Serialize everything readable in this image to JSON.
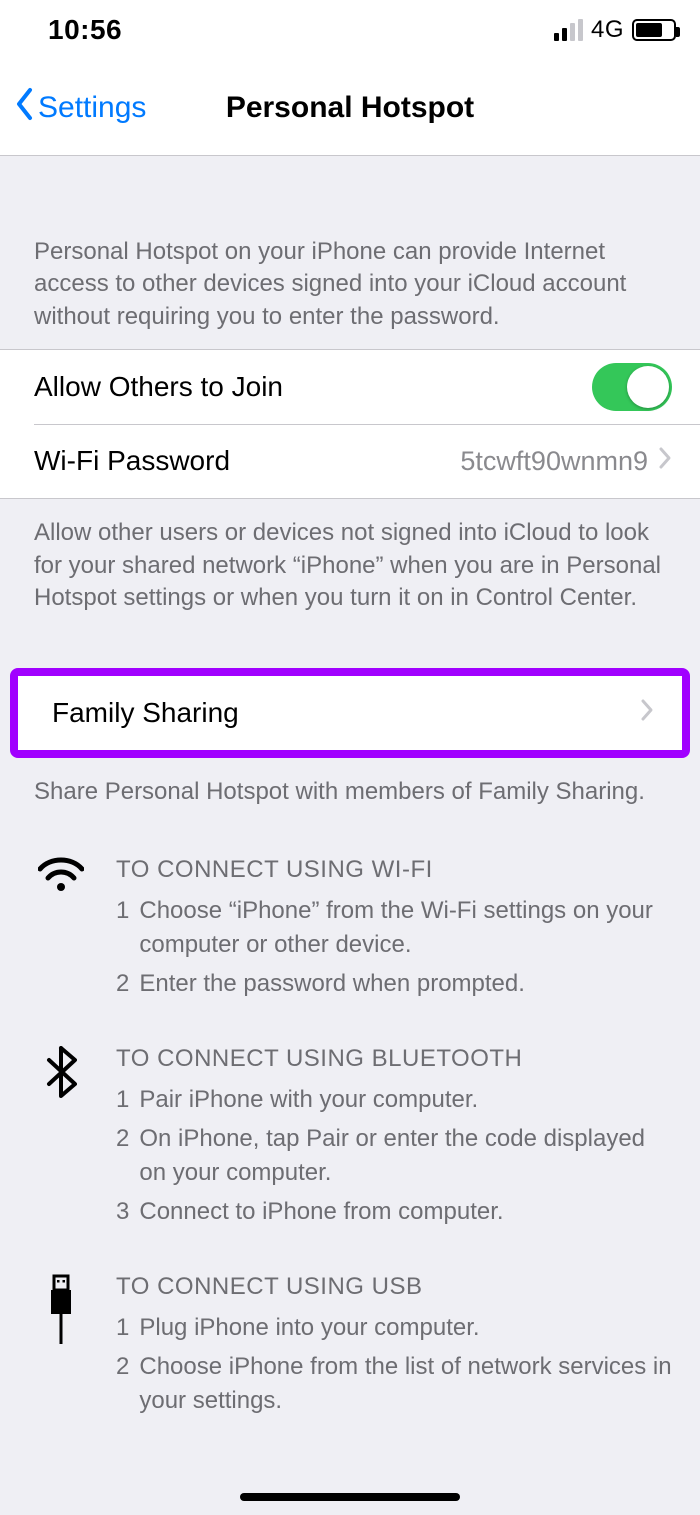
{
  "status": {
    "time": "10:56",
    "network": "4G"
  },
  "nav": {
    "back": "Settings",
    "title": "Personal Hotspot"
  },
  "intro": "Personal Hotspot on your iPhone can provide Internet access to other devices signed into your iCloud account without requiring you to enter the password.",
  "rows": {
    "allow_label": "Allow Others to Join",
    "wifipw_label": "Wi-Fi Password",
    "wifipw_value": "5tcwft90wnmn9"
  },
  "allow_desc": "Allow other users or devices not signed into iCloud to look for your shared network “iPhone” when you are in Personal Hotspot settings or when you turn it on in Control Center.",
  "family": {
    "label": "Family Sharing"
  },
  "family_desc": "Share Personal Hotspot with members of Family Sharing.",
  "instr": {
    "wifi": {
      "title": "TO CONNECT USING WI-FI",
      "s1": "Choose “iPhone” from the Wi-Fi settings on your computer or other device.",
      "s2": "Enter the password when prompted."
    },
    "bt": {
      "title": "TO CONNECT USING BLUETOOTH",
      "s1": "Pair iPhone with your computer.",
      "s2": "On iPhone, tap Pair or enter the code displayed on your computer.",
      "s3": "Connect to iPhone from computer."
    },
    "usb": {
      "title": "TO CONNECT USING USB",
      "s1": "Plug iPhone into your computer.",
      "s2": "Choose iPhone from the list of network services in your settings."
    }
  }
}
